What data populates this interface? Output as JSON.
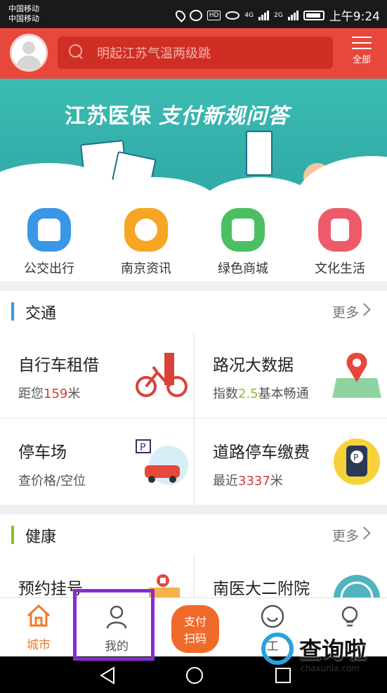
{
  "status_bar": {
    "carrier1": "中国移动",
    "carrier2": "中国移动",
    "net1": "4G",
    "net2": "2G",
    "time": "上午9:24",
    "icons": [
      "location-icon",
      "alarm-icon",
      "hd-icon",
      "eye-icon",
      "signal-icon",
      "signal-icon",
      "battery-icon"
    ]
  },
  "header": {
    "search_placeholder": "明起江苏气温两级跳",
    "all_label": "全部"
  },
  "banner": {
    "title_part1": "江苏医保",
    "title_part2": "支付新规问答"
  },
  "quick_links": [
    {
      "label": "公交出行",
      "icon": "bus-icon",
      "color": "#3a97e8"
    },
    {
      "label": "南京资讯",
      "icon": "chat-icon",
      "color": "#f6a623"
    },
    {
      "label": "绿色商城",
      "icon": "shop-icon",
      "color": "#4cbf63"
    },
    {
      "label": "文化生活",
      "icon": "book-icon",
      "color": "#ef5a6a"
    }
  ],
  "sections": {
    "traffic": {
      "title": "交通",
      "more": "更多",
      "accent": "#3a97e8"
    },
    "health": {
      "title": "健康",
      "more": "更多",
      "accent": "#8cbd2f"
    }
  },
  "traffic_cards": [
    {
      "title": "自行车租借",
      "sub_pre": "距您",
      "sub_hl": "159",
      "sub_post": "米",
      "icon": "bicycle-icon"
    },
    {
      "title": "路况大数据",
      "sub_pre": "指数",
      "sub_hl": "2.5",
      "sub_post": "基本畅通",
      "icon": "map-pin-icon"
    },
    {
      "title": "停车场",
      "sub_pre": "查价格/空位",
      "sub_hl": "",
      "sub_post": "",
      "icon": "parking-car-icon"
    },
    {
      "title": "道路停车缴费",
      "sub_pre": "最近",
      "sub_hl": "3337",
      "sub_post": "米",
      "icon": "parking-meter-icon"
    }
  ],
  "health_cards": [
    {
      "title": "预约挂号",
      "icon": "hospital-icon"
    },
    {
      "title": "南医大二附院",
      "icon": "hospital-logo-icon"
    }
  ],
  "tabbar": [
    {
      "label": "城市",
      "icon": "home-icon",
      "active": true
    },
    {
      "label": "我的",
      "icon": "user-icon",
      "active": false
    },
    {
      "label1": "支付",
      "label2": "扫码",
      "icon": "scan-pay-icon"
    },
    {
      "label": "工",
      "icon": "service-icon",
      "active": false
    },
    {
      "label": "",
      "icon": "bulb-icon",
      "active": false
    }
  ],
  "watermark": {
    "text": "查询啦",
    "url": "chaxunla.com"
  },
  "colors": {
    "header": "#e8473c",
    "active_tab": "#f07a2a",
    "highlight_border": "#8a2bd1"
  }
}
